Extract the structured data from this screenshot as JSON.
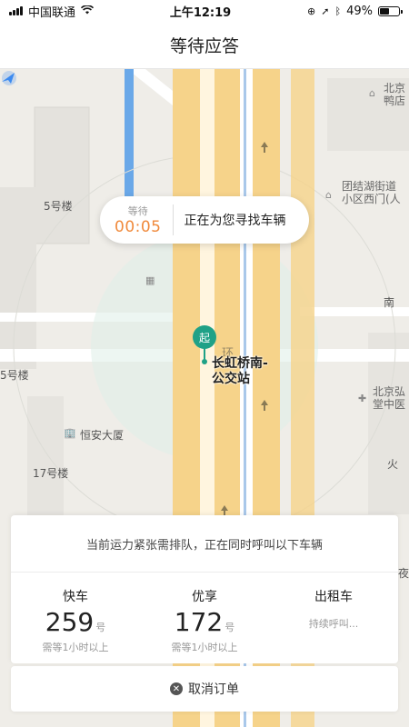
{
  "status": {
    "carrier": "中国联通",
    "time": "上午12:19",
    "battery": "49%"
  },
  "header": {
    "title": "等待应答"
  },
  "map": {
    "labels": {
      "building5": "5号楼",
      "building5b": "5号楼",
      "building17": "17号楼",
      "hengan": "恒安大厦",
      "beijing_duck": "北京",
      "beijing_duck2": "鸭店",
      "tuanjiehu": "团结湖街道",
      "tuanjiehu2": "小区西门(人",
      "beijing_hong": "北京弘",
      "beijing_hong2": "堂中医",
      "nan": "南",
      "huo": "火",
      "ye": "夜",
      "huan": "环"
    },
    "stop_name_line1": "长虹桥南-",
    "stop_name_line2": "公交站",
    "pin_label": "起"
  },
  "wait_bubble": {
    "label": "等待",
    "timer": "00:05",
    "message": "正在为您寻找车辆"
  },
  "card": {
    "message": "当前运力紧张需排队，正在同时呼叫以下车辆",
    "options": [
      {
        "name": "快车",
        "count": "259",
        "unit": "号",
        "wait": "需等1小时以上"
      },
      {
        "name": "优享",
        "count": "172",
        "unit": "号",
        "wait": "需等1小时以上"
      },
      {
        "name": "出租车",
        "status": "持续呼叫..."
      }
    ]
  },
  "cancel": {
    "label": "取消订单"
  },
  "colors": {
    "accent_orange": "#f08a3c",
    "pin_green": "#1fa187",
    "road_yellow": "#f6d38a",
    "water_blue": "#6aa8e8"
  }
}
